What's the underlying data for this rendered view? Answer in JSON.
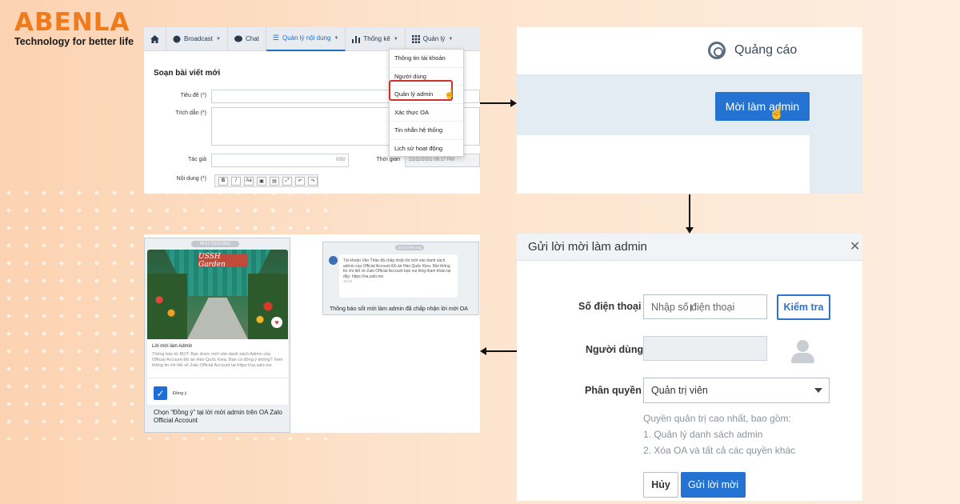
{
  "brand": {
    "name": "ABENLA",
    "tagline": "Technology for better life",
    "color": "#f07b1c"
  },
  "panel1": {
    "nav": [
      {
        "label": "",
        "icon": "home-icon"
      },
      {
        "label": "Broadcast",
        "icon": "broadcast-icon"
      },
      {
        "label": "Chat",
        "icon": "chat-icon"
      },
      {
        "label": "Quản lý nội dung",
        "icon": "list-icon",
        "active": true
      },
      {
        "label": "Thống kê",
        "icon": "bar-chart-icon"
      },
      {
        "label": "Quản lý",
        "icon": "grid-icon"
      }
    ],
    "title": "Soạn bài viết mới",
    "fields": {
      "title_label": "Tiêu đề (*)",
      "excerpt_label": "Trích dẫn (*)",
      "author_label": "Tác giả",
      "author_counter": "0/50",
      "time_label": "Thời gian",
      "time_value": "21/11/2021 06:17 PM",
      "content_label": "Nội dung (*)"
    },
    "dropdown": [
      "Thông tin tài khoản",
      "Người dùng",
      "Quản lý admin",
      "Xác thực OA",
      "Tin nhắn hệ thống",
      "Lịch sử hoạt động"
    ],
    "highlight_color": "#d0312d"
  },
  "panel2": {
    "section": "Quảng cáo",
    "invite_button": "Mời làm admin",
    "button_color": "#2472d1"
  },
  "panel3": {
    "title": "Gửi lời mời làm admin",
    "phone_label": "Số điện thoại",
    "phone_placeholder": "Nhập số điện thoại",
    "check_button": "Kiểm tra",
    "user_label": "Người dùng",
    "role_label": "Phân quyền",
    "role_value": "Quản trị viên",
    "perm_intro": "Quyền quản trị cao nhất, bao gồm:",
    "perm_1": "1. Quản lý danh sách admin",
    "perm_2": "2. Xóa OA và tất cả các quyền khác",
    "cancel_button": "Hủy",
    "send_button": "Gửi lời mời"
  },
  "panel4": {
    "card_time": "06:52 22/11/2021",
    "garden_sign": "USSH Garden",
    "card_title": "Lời mời làm Admin",
    "card_body": "Thông báo từ BOT: Bạn được mời vào danh sách Admin của Official Account Đồ án Hàn Quốc Kiea. Bạn có đồng ý không? Xem thông tin chi tiết về Zalo Official Account tại https://oa.zalo.me",
    "agree_label": "Đồng ý",
    "caption_left": "Chọn “Đồng ý” tại lời mời admin trên OA Zalo Official Account",
    "notif_time": "18:22 Hôm nay",
    "notif_body": "Tài khoản Văn Thảo đã chấp nhận lời mời vào danh sách admin của Official Account Đồ án Hàn Quốc Kiea. Mọi thông tin chi tiết về Zalo Official Account bạn vui lòng tham khảo tại đây: https://oa.zalo.me",
    "notif_clock": "18:22",
    "caption_right": "Thông báo sốt mời làm admin đã chấp nhận lời mời OA"
  }
}
